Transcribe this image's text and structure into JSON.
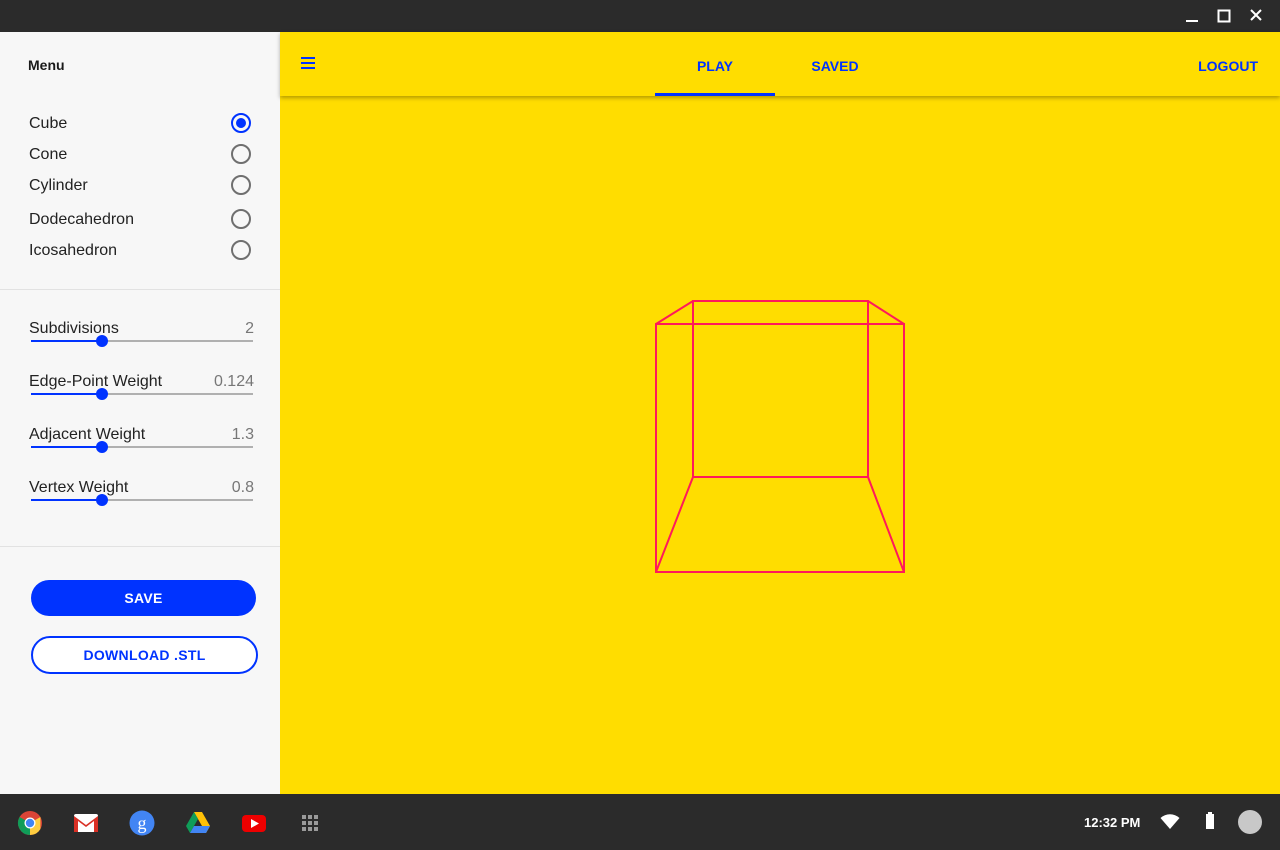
{
  "window": {
    "controls": [
      "minimize-icon",
      "maximize-icon",
      "close-icon"
    ]
  },
  "sidebar": {
    "title": "Menu",
    "shapes": [
      {
        "label": "Cube",
        "selected": true
      },
      {
        "label": "Cone",
        "selected": false
      },
      {
        "label": "Cylinder",
        "selected": false
      },
      {
        "label": "Dodecahedron",
        "selected": false
      },
      {
        "label": "Icosahedron",
        "selected": false
      }
    ],
    "sliders": [
      {
        "label": "Subdivisions",
        "value": "2",
        "level": 0.32
      },
      {
        "label": "Edge-Point Weight",
        "value": "0.124",
        "level": 0.32
      },
      {
        "label": "Adjacent Weight",
        "value": "1.3",
        "level": 0.32
      },
      {
        "label": "Vertex Weight",
        "value": "0.8",
        "level": 0.32
      }
    ],
    "save_label": "SAVE",
    "download_label": "DOWNLOAD .STL"
  },
  "appbar": {
    "tabs": [
      {
        "label": "PLAY",
        "active": true
      },
      {
        "label": "SAVED",
        "active": false
      }
    ],
    "logout_label": "LOGOUT"
  },
  "viewport": {
    "model": "Cube",
    "wire_color": "#ff1a5a"
  },
  "shelf": {
    "apps": [
      "chrome-icon",
      "gmail-icon",
      "google-search-icon",
      "drive-icon",
      "youtube-icon",
      "launcher-icon"
    ],
    "time": "12:32 PM",
    "status_icons": [
      "wifi-icon",
      "battery-icon"
    ]
  },
  "colors": {
    "accent": "#0033ff",
    "background": "#ffdd00",
    "sidebar": "#f7f7f7",
    "shelf": "#2b2b2b"
  }
}
